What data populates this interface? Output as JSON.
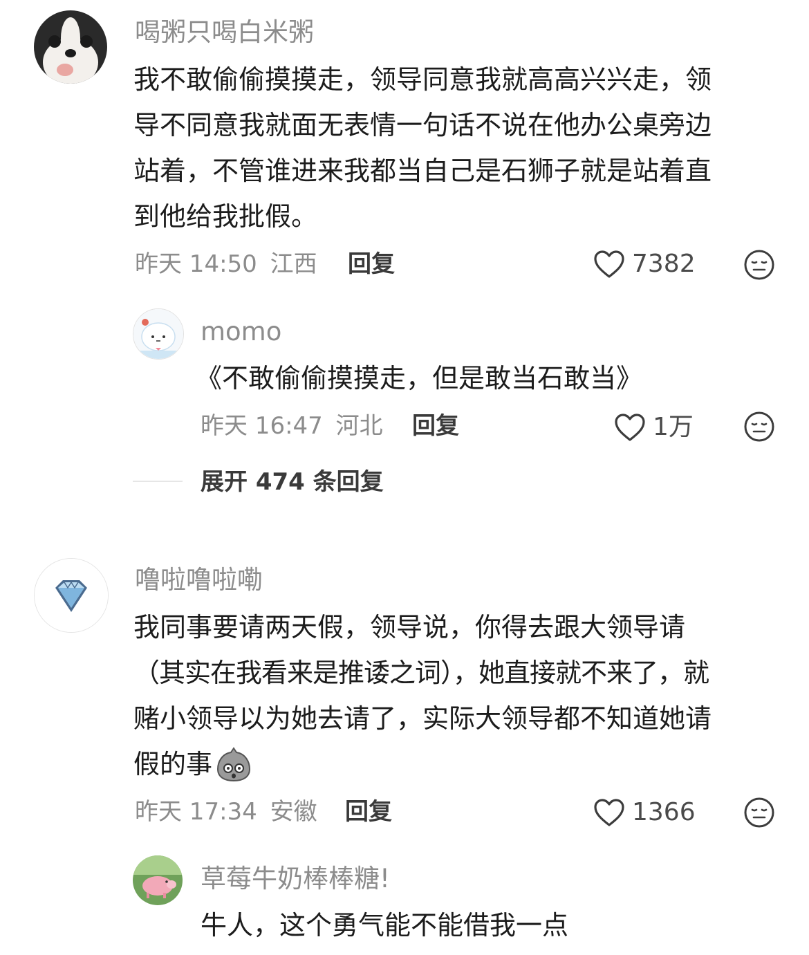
{
  "comments": [
    {
      "username": "喝粥只喝白米粥",
      "lines": [
        "我不敢偷偷摸摸走，领导同意我就高高兴兴走，领",
        "导不同意我就面无表情一句话不说在他办公桌旁边",
        "站着，不管谁进来我都当自己是石狮子就是站着直",
        "到他给我批假。"
      ],
      "time": "昨天 14:50",
      "location": "江西",
      "reply_label": "回复",
      "likes": "7382",
      "avatar_icon": "dog-avatar-icon",
      "replies": [
        {
          "username": "momo",
          "text": "《不敢偷偷摸摸走，但是敢当石敢当》",
          "time": "昨天 16:47",
          "location": "河北",
          "reply_label": "回复",
          "likes": "1万",
          "avatar_icon": "cartoon-cloud-avatar-icon"
        }
      ],
      "expand_label": "展开 474 条回复"
    },
    {
      "username": "噜啦噜啦嘞",
      "lines": [
        "我同事要请两天假，领导说，你得去跟大领导请",
        "（其实在我看来是推诿之词），她直接就不来了，就",
        "赌小领导以为她去请了，实际大领导都不知道她请",
        "假的事"
      ],
      "time": "昨天 17:34",
      "location": "安徽",
      "reply_label": "回复",
      "likes": "1366",
      "avatar_icon": "diamond-avatar-icon",
      "replies": [
        {
          "username": "草莓牛奶棒棒糖!",
          "text": "牛人，这个勇气能不能借我一点",
          "avatar_icon": "pig-avatar-icon"
        }
      ]
    }
  ],
  "colors": {
    "meta_gray": "#8c8c8c",
    "text_dark": "#1c1c1c"
  }
}
